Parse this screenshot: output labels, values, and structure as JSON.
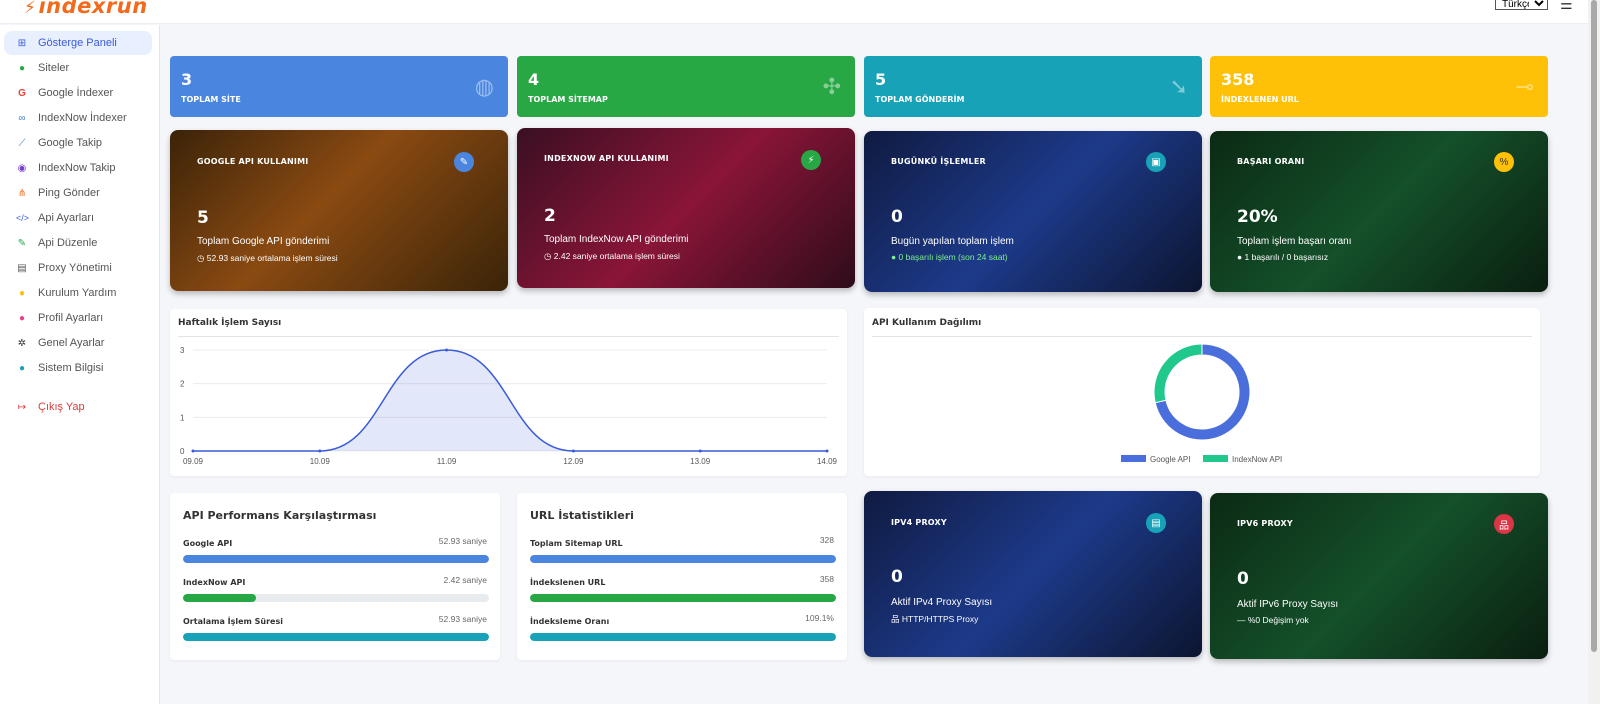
{
  "header": {
    "logo_text": "indexrun",
    "language": "Türkçe"
  },
  "sidebar": {
    "items": [
      {
        "label": "Gösterge Paneli",
        "icon": "dashboard-icon",
        "active": true
      },
      {
        "label": "Siteler",
        "icon": "globe-icon"
      },
      {
        "label": "Google İndexer",
        "icon": "google-icon"
      },
      {
        "label": "IndexNow İndexer",
        "icon": "link-icon"
      },
      {
        "label": "Google Takip",
        "icon": "chart-line-icon"
      },
      {
        "label": "IndexNow Takip",
        "icon": "compass-icon"
      },
      {
        "label": "Ping Gönder",
        "icon": "broadcast-icon"
      },
      {
        "label": "Api Ayarları",
        "icon": "code-icon"
      },
      {
        "label": "Api Düzenle",
        "icon": "edit-icon"
      },
      {
        "label": "Proxy Yönetimi",
        "icon": "server-icon"
      },
      {
        "label": "Kurulum Yardım",
        "icon": "help-icon"
      },
      {
        "label": "Profil Ayarları",
        "icon": "user-icon"
      },
      {
        "label": "Genel Ayarlar",
        "icon": "gear-icon"
      },
      {
        "label": "Sistem Bilgisi",
        "icon": "info-icon"
      }
    ],
    "logout": "Çıkış Yap"
  },
  "stats": [
    {
      "value": "3",
      "label": "TOPLAM SİTE",
      "color": "#4a86e0"
    },
    {
      "value": "4",
      "label": "TOPLAM SİTEMAP",
      "color": "#28a745"
    },
    {
      "value": "5",
      "label": "TOPLAM GÖNDERİM",
      "color": "#17a2b8"
    },
    {
      "value": "358",
      "label": "İNDEXLENEN URL",
      "color": "#ffc107"
    }
  ],
  "cards": {
    "google": {
      "title": "GOOGLE API KULLANIMI",
      "value": "5",
      "subtitle": "Toplam Google API gönderimi",
      "detail": "52.93 saniye ortalama işlem süresi"
    },
    "indexnow": {
      "title": "INDEXNOW API KULLANIMI",
      "value": "2",
      "subtitle": "Toplam IndexNow API gönderimi",
      "detail": "2.42 saniye ortalama işlem süresi"
    },
    "today": {
      "title": "BUGÜNKÜ İŞLEMLER",
      "value": "0",
      "subtitle": "Bugün yapılan toplam işlem",
      "detail": "0 başarılı işlem (son 24 saat)"
    },
    "success": {
      "title": "BAŞARI ORANI",
      "value": "20%",
      "subtitle": "Toplam işlem başarı oranı",
      "detail": "1 başarılı / 0 başarısız"
    },
    "ipv4": {
      "title": "IPV4 PROXY",
      "value": "0",
      "subtitle": "Aktif IPv4 Proxy Sayısı",
      "detail": "HTTP/HTTPS Proxy"
    },
    "ipv6": {
      "title": "IPV6 PROXY",
      "value": "0",
      "subtitle": "Aktif IPv6 Proxy Sayısı",
      "detail": "— %0 Değişim yok"
    }
  },
  "weekly_chart": {
    "title": "Haftalık İşlem Sayısı",
    "chart_data": {
      "type": "area",
      "categories": [
        "09.09",
        "10.09",
        "11.09",
        "12.09",
        "13.09",
        "14.09"
      ],
      "values": [
        0,
        0,
        3,
        0,
        0,
        0
      ],
      "ylim": [
        0,
        3
      ],
      "yticks": [
        "0",
        "1",
        "2",
        "3"
      ],
      "color": "#3a5bd9"
    }
  },
  "api_chart": {
    "title": "API Kullanım Dağılımı",
    "chart_data": {
      "type": "pie",
      "donut": true,
      "legend_position": "bottom",
      "slices": [
        {
          "name": "Google API",
          "value": 5,
          "color": "#4a6fdc"
        },
        {
          "name": "IndexNow API",
          "value": 2,
          "color": "#20c98b"
        }
      ]
    }
  },
  "performance": {
    "title": "API Performans Karşılaştırması",
    "rows": [
      {
        "label": "Google API",
        "value": "52.93 saniye",
        "fill": 1.0,
        "color": "#4a86e0"
      },
      {
        "label": "IndexNow API",
        "value": "2.42 saniye",
        "fill": 0.24,
        "color": "#28a745"
      },
      {
        "label": "Ortalama İşlem Süresi",
        "value": "52.93 saniye",
        "fill": 1.0,
        "color": "#17a2b8"
      }
    ]
  },
  "url_stats": {
    "title": "URL İstatistikleri",
    "rows": [
      {
        "label": "Toplam Sitemap URL",
        "value": "328",
        "fill": 1.0,
        "color": "#4a86e0"
      },
      {
        "label": "İndekslenen URL",
        "value": "358",
        "fill": 1.0,
        "color": "#28a745"
      },
      {
        "label": "İndeksleme Oranı",
        "value": "109.1%",
        "fill": 1.0,
        "color": "#17a2b8"
      }
    ]
  }
}
